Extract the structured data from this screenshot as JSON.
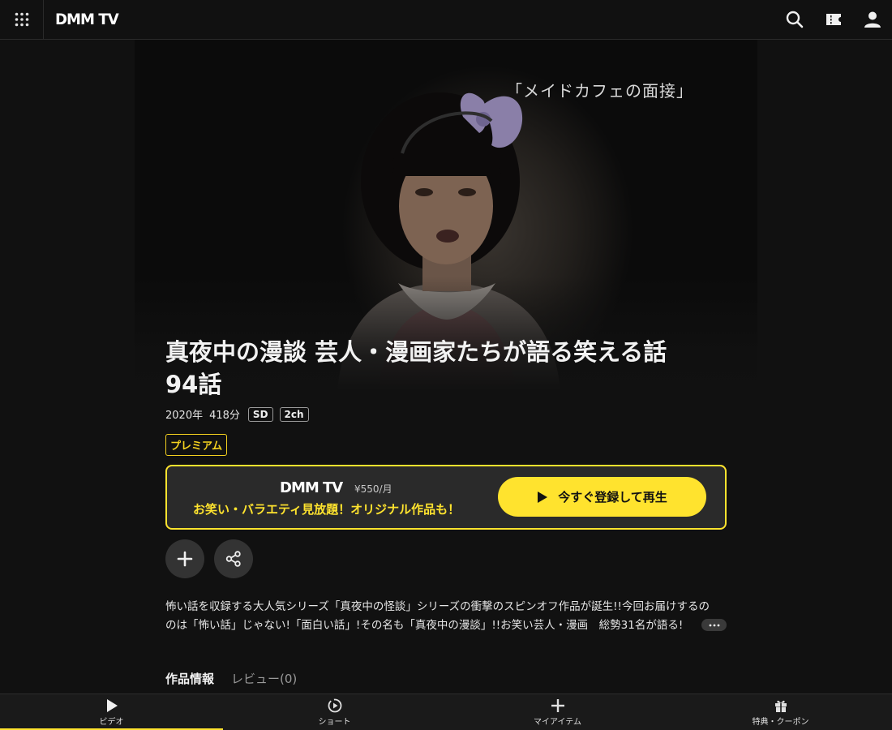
{
  "header": {
    "logo": "DMM TV",
    "icons": [
      "grid-menu-icon",
      "search-icon",
      "ticket-icon",
      "user-icon"
    ]
  },
  "hero": {
    "caption": "「メイドカフェの面接」"
  },
  "title": {
    "line1": "真夜中の漫談 芸人・漫画家たちが語る笑える話",
    "line2": "94話"
  },
  "meta": {
    "year": "2020年",
    "duration": "418分",
    "badges": [
      "SD",
      "2ch"
    ]
  },
  "premium_label": "プレミアム",
  "promo": {
    "logo": "DMM TV",
    "price": "¥550/月",
    "tagline": "お笑い・バラエティ見放題！オリジナル作品も！",
    "cta_label": "今すぐ登録して再生"
  },
  "actions": {
    "add_icon": "plus-icon",
    "share_icon": "share-icon"
  },
  "description": {
    "line1": "怖い話を収録する大人気シリーズ「真夜中の怪談」シリーズの衝撃のスピンオフ作品が誕生!!今回お届けするの",
    "line2": "のは「怖い話」じゃない!「面白い話」!その名も「真夜中の漫談」!!お笑い芸人・漫画　総勢31名が語る!",
    "more_label": "…"
  },
  "tabs": {
    "info": "作品情報",
    "review": "レビュー(0)"
  },
  "bottom_nav": {
    "items": [
      {
        "label": "ビデオ",
        "icon": "play-icon",
        "active": true
      },
      {
        "label": "ショート",
        "icon": "short-play-icon",
        "active": false
      },
      {
        "label": "マイアイテム",
        "icon": "plus-icon",
        "active": false
      },
      {
        "label": "特典・クーポン",
        "icon": "gift-icon",
        "active": false
      }
    ]
  },
  "colors": {
    "accent": "#ffe32e",
    "background": "#111111",
    "surface": "#2a2a2a"
  }
}
